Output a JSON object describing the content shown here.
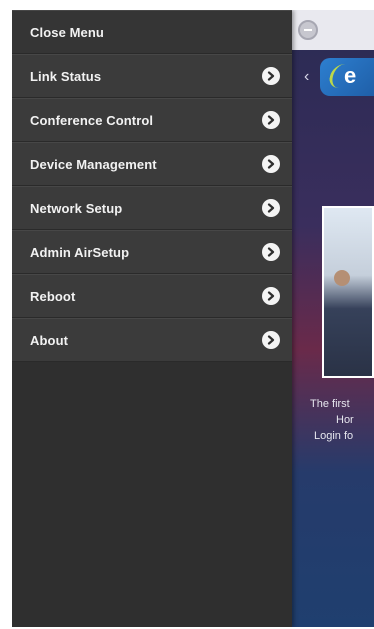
{
  "menu": {
    "close_label": "Close Menu",
    "items": [
      {
        "label": "Link Status"
      },
      {
        "label": "Conference Control"
      },
      {
        "label": "Device Management"
      },
      {
        "label": "Network Setup"
      },
      {
        "label": "Admin AirSetup"
      },
      {
        "label": "Reboot"
      },
      {
        "label": "About"
      }
    ]
  },
  "background": {
    "promo_lines": [
      "The first",
      "Hor",
      "Login fo"
    ]
  }
}
